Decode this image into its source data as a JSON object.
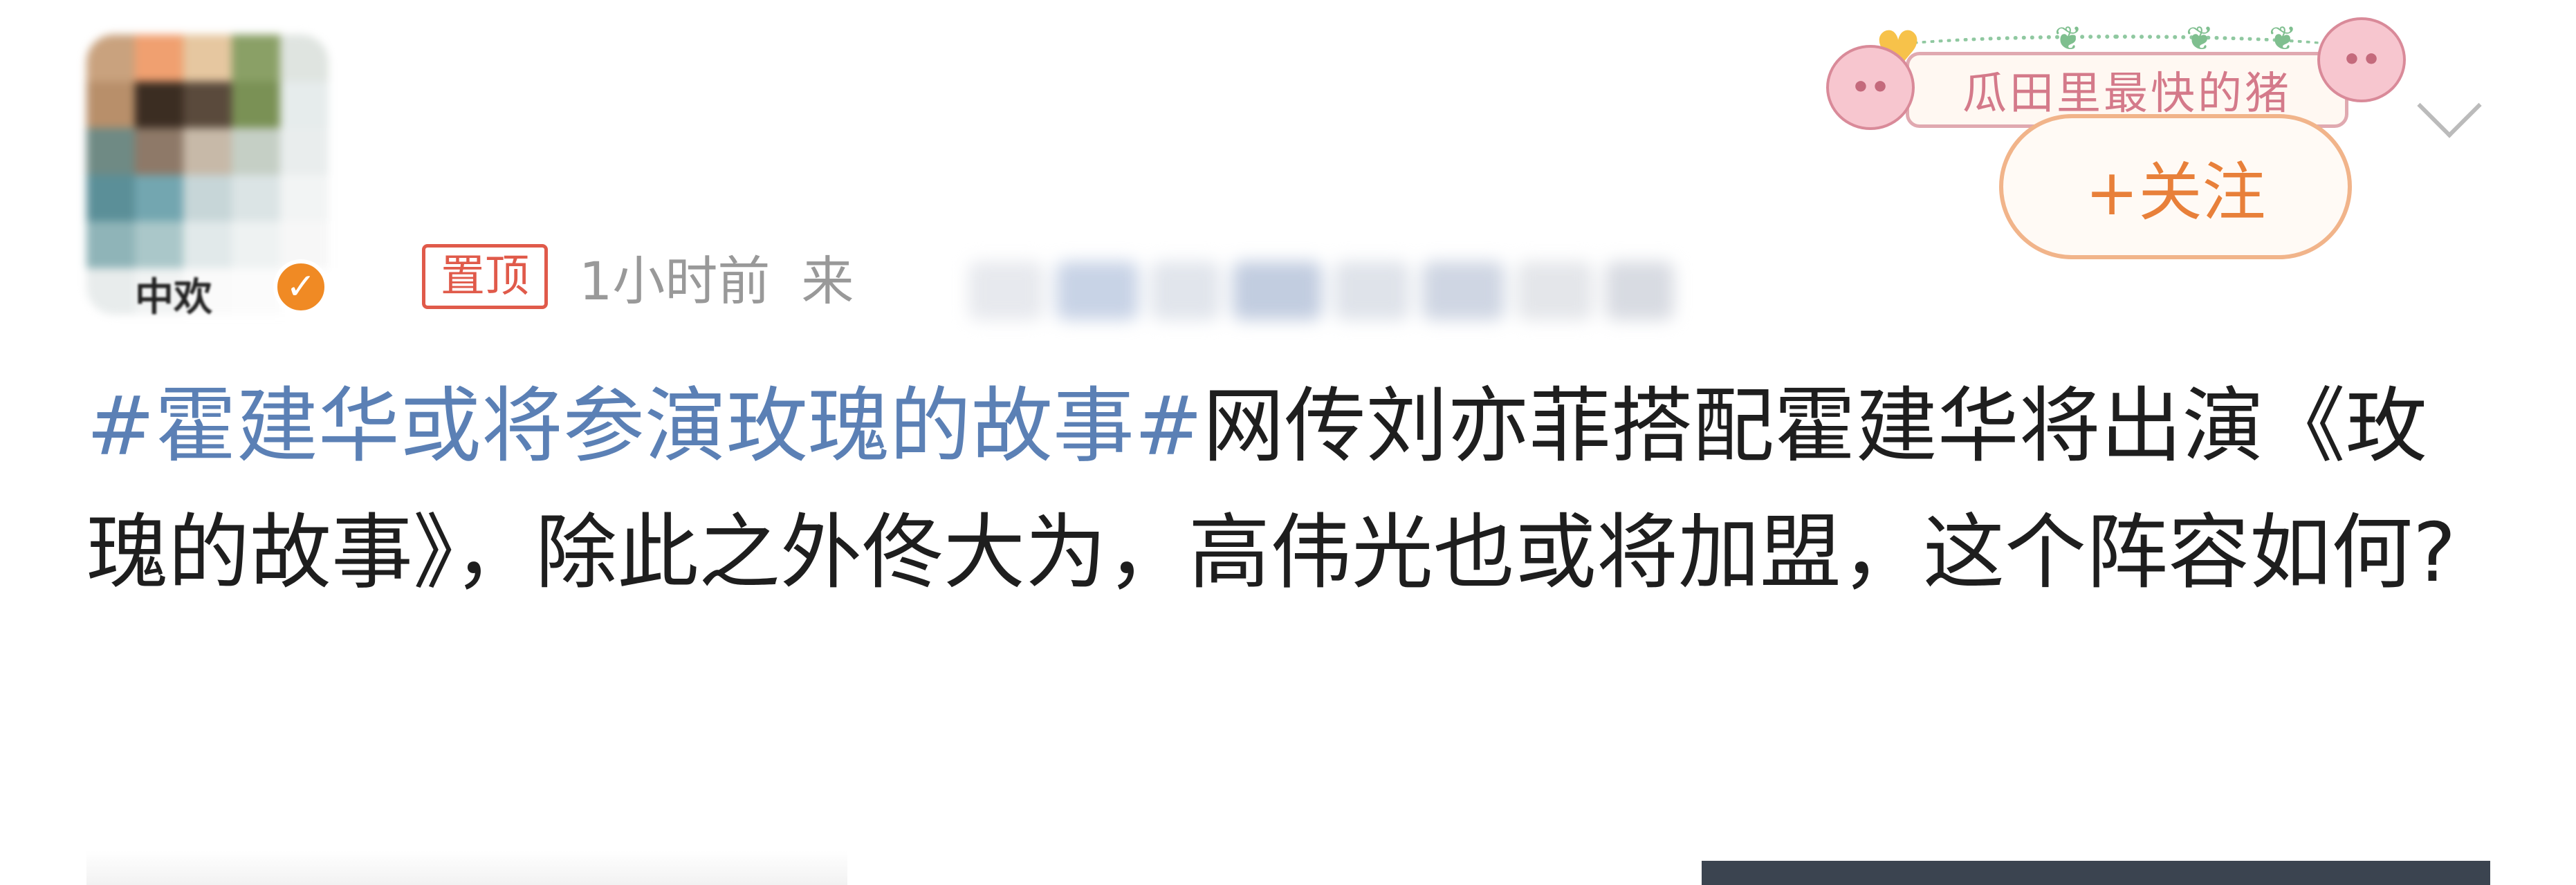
{
  "post": {
    "author": {
      "name": "",
      "avatar_caption": "中欢",
      "verified_mark": "✓"
    },
    "pinned_label": "置顶",
    "time": "1小时前",
    "from_label": "来",
    "fan_badge_text": "瓜田里最快的猪",
    "follow_button": "+关注",
    "hashtag": "#霍建华或将参演玫瑰的故事#",
    "body": "网传刘亦菲搭配霍建华将出演《玫瑰的故事》，除此之外佟大为，高伟光也或将加盟，这个阵容如何?"
  },
  "colors": {
    "hashtag": "#5b80b5",
    "pinned": "#e05a4a",
    "follow": "#e8803a",
    "meta": "#999999",
    "text": "#1e1e1e"
  },
  "icons": [
    "verified-icon",
    "heart-icon",
    "pig-icon",
    "chevron-down-icon"
  ]
}
